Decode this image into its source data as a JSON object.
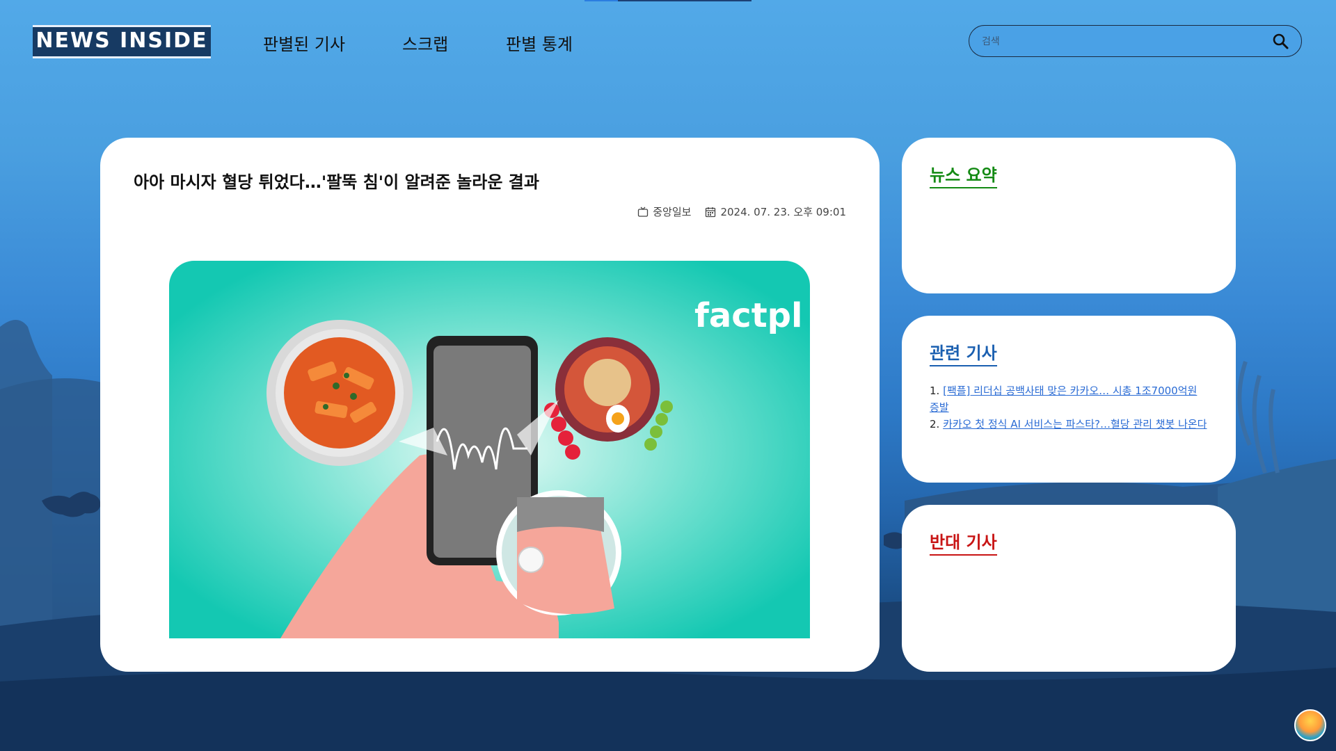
{
  "header": {
    "logo": "NEWS INSIDE",
    "nav": [
      {
        "label": "판별된 기사"
      },
      {
        "label": "스크랩"
      },
      {
        "label": "판별 통계"
      }
    ],
    "search": {
      "placeholder": "검색",
      "icon": "search-icon"
    }
  },
  "article": {
    "title": "아아 마시자 혈당 튀었다…'팔뚝 침'이 알려준 놀라운 결과",
    "source": "중앙일보",
    "date": "2024. 07. 23. 오후 09:01",
    "image": {
      "watermark": "factpl"
    }
  },
  "sidebar": {
    "summary": {
      "title": "뉴스 요약",
      "color": "#148a14"
    },
    "related": {
      "title": "관련 기사",
      "color": "#1a5fb0",
      "items": [
        {
          "num": "1.",
          "text": "[팩플] 리더십 공백사태 맞은 카카오… 시총 1조7000억원 증발"
        },
        {
          "num": "2.",
          "text": "카카오 첫 정식 AI 서비스는 파스타?…혈당 관리 챗봇 나온다"
        }
      ]
    },
    "opposing": {
      "title": "반대 기사",
      "color": "#c81414"
    }
  },
  "colors": {
    "accent": "#2a6bd4",
    "logo_bg": "#173a63",
    "hero_bg": "#17c9b4"
  }
}
